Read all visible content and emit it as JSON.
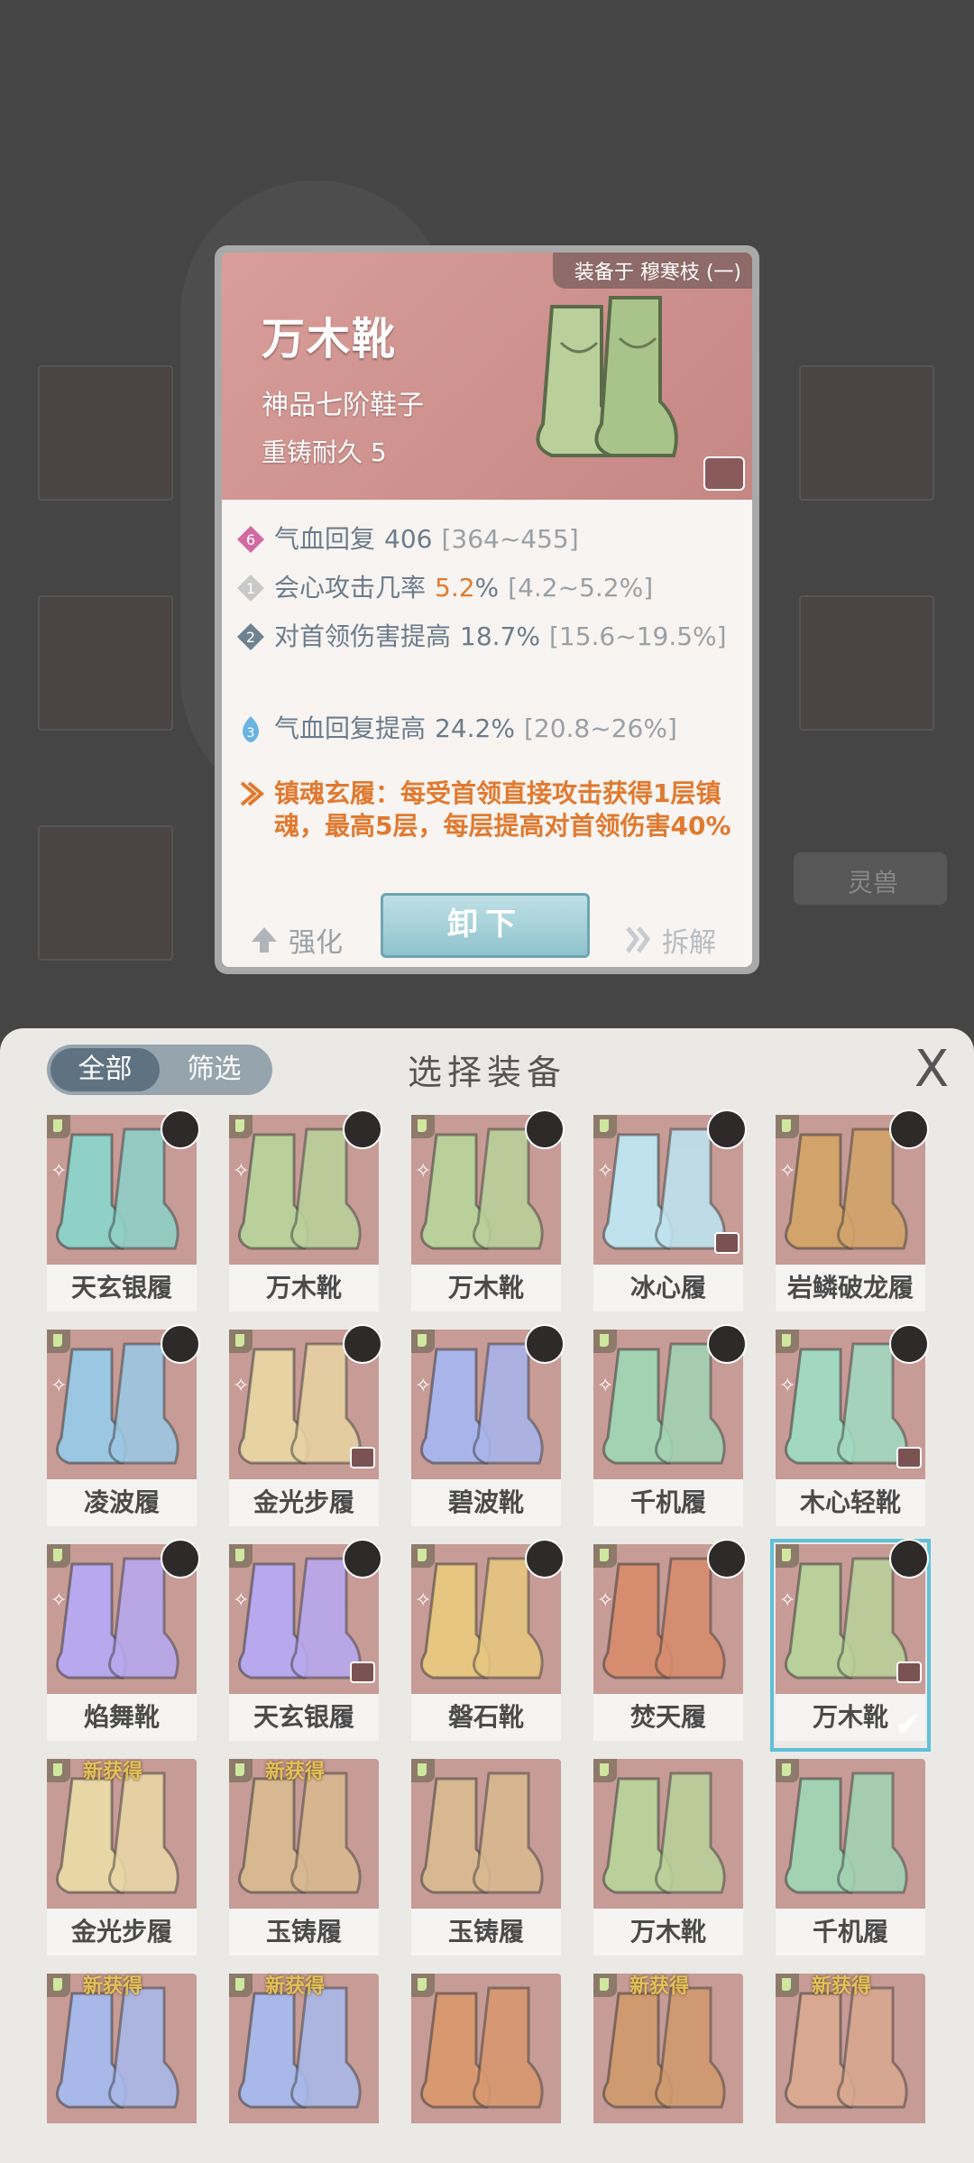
{
  "background_tab": "灵兽",
  "detail": {
    "equipped_label": "装备于 穆寒枝 (一)",
    "name": "万木靴",
    "grade": "神品七阶鞋子",
    "durability": "重铸耐久 5",
    "stats": [
      {
        "badge": "6",
        "badge_color": "#d16aa3",
        "name": "气血回复",
        "value": "406",
        "range": "[364~455]"
      },
      {
        "badge": "1",
        "badge_color": "#c9c9c9",
        "name": "会心攻击几率",
        "value": "5.2",
        "unit": "%",
        "range": "[4.2~5.2%]"
      },
      {
        "badge": "2",
        "badge_color": "#6f8290",
        "name": "对首领伤害提高",
        "value": "18.7%",
        "range": "[15.6~19.5%]"
      },
      {
        "badge": "3",
        "badge_color": "#6ab3e0",
        "name": "气血回复提高",
        "value": "24.2%",
        "range": "[20.8~26%]"
      }
    ],
    "set_effect": "镇魂玄履：每受首领直接攻击获得1层镇魂，最高5层，每层提高对首领伤害40%",
    "btn_enhance": "强化",
    "btn_unequip": "卸下",
    "btn_dismantle": "拆解"
  },
  "panel": {
    "filter_all": "全部",
    "filter_screen": "筛选",
    "title": "选择装备",
    "close": "X",
    "items": [
      {
        "name": "天玄银履",
        "color": "#8fd0c7"
      },
      {
        "name": "万木靴",
        "color": "#b9d09a"
      },
      {
        "name": "万木靴",
        "color": "#b9d09a"
      },
      {
        "name": "冰心履",
        "color": "#bfe2ee"
      },
      {
        "name": "岩鳞破龙履",
        "color": "#d2a36a"
      },
      {
        "name": "凌波履",
        "color": "#9cc7e2"
      },
      {
        "name": "金光步履",
        "color": "#e6d2a2"
      },
      {
        "name": "碧波靴",
        "color": "#a9b4ea"
      },
      {
        "name": "千机履",
        "color": "#a2d2b2"
      },
      {
        "name": "木心轻靴",
        "color": "#a2d8c0"
      },
      {
        "name": "焰舞靴",
        "color": "#b8a8ee"
      },
      {
        "name": "天玄银履",
        "color": "#b8a8ee"
      },
      {
        "name": "磐石靴",
        "color": "#e6c680"
      },
      {
        "name": "焚天履",
        "color": "#d68c6e"
      },
      {
        "name": "万木靴",
        "color": "#b9d09a"
      },
      {
        "name": "金光步履",
        "color": "#e8d6a6",
        "new": "新获得"
      },
      {
        "name": "玉铸履",
        "color": "#d8b890",
        "new": "新获得"
      },
      {
        "name": "玉铸履",
        "color": "#d8b890"
      },
      {
        "name": "万木靴",
        "color": "#b9d09a"
      },
      {
        "name": "千机履",
        "color": "#a2d2b2"
      },
      {
        "name": "",
        "color": "#a8b8e8",
        "new": "新获得"
      },
      {
        "name": "",
        "color": "#a8b8e8",
        "new": "新获得"
      },
      {
        "name": "",
        "color": "#d89870"
      },
      {
        "name": "",
        "color": "#d09a70",
        "new": "新获得"
      },
      {
        "name": "",
        "color": "#d8a890",
        "new": "新获得"
      }
    ]
  }
}
